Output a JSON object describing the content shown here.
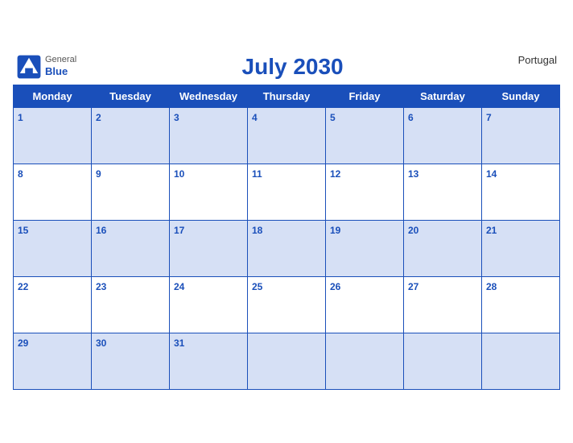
{
  "header": {
    "title": "July 2030",
    "country": "Portugal",
    "logo": {
      "general": "General",
      "blue": "Blue"
    }
  },
  "weekdays": [
    "Monday",
    "Tuesday",
    "Wednesday",
    "Thursday",
    "Friday",
    "Saturday",
    "Sunday"
  ],
  "weeks": [
    [
      {
        "day": 1,
        "empty": false
      },
      {
        "day": 2,
        "empty": false
      },
      {
        "day": 3,
        "empty": false
      },
      {
        "day": 4,
        "empty": false
      },
      {
        "day": 5,
        "empty": false
      },
      {
        "day": 6,
        "empty": false
      },
      {
        "day": 7,
        "empty": false
      }
    ],
    [
      {
        "day": 8,
        "empty": false
      },
      {
        "day": 9,
        "empty": false
      },
      {
        "day": 10,
        "empty": false
      },
      {
        "day": 11,
        "empty": false
      },
      {
        "day": 12,
        "empty": false
      },
      {
        "day": 13,
        "empty": false
      },
      {
        "day": 14,
        "empty": false
      }
    ],
    [
      {
        "day": 15,
        "empty": false
      },
      {
        "day": 16,
        "empty": false
      },
      {
        "day": 17,
        "empty": false
      },
      {
        "day": 18,
        "empty": false
      },
      {
        "day": 19,
        "empty": false
      },
      {
        "day": 20,
        "empty": false
      },
      {
        "day": 21,
        "empty": false
      }
    ],
    [
      {
        "day": 22,
        "empty": false
      },
      {
        "day": 23,
        "empty": false
      },
      {
        "day": 24,
        "empty": false
      },
      {
        "day": 25,
        "empty": false
      },
      {
        "day": 26,
        "empty": false
      },
      {
        "day": 27,
        "empty": false
      },
      {
        "day": 28,
        "empty": false
      }
    ],
    [
      {
        "day": 29,
        "empty": false
      },
      {
        "day": 30,
        "empty": false
      },
      {
        "day": 31,
        "empty": false
      },
      {
        "day": null,
        "empty": true
      },
      {
        "day": null,
        "empty": true
      },
      {
        "day": null,
        "empty": true
      },
      {
        "day": null,
        "empty": true
      }
    ]
  ]
}
